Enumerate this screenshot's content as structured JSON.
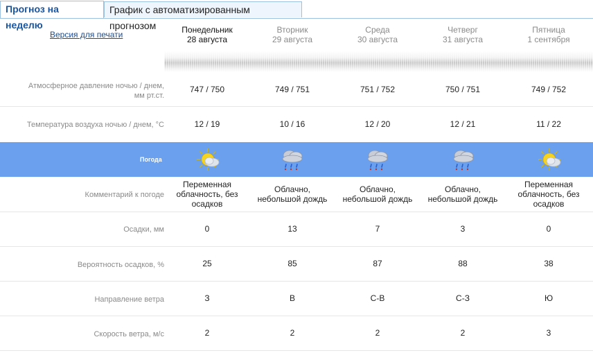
{
  "tabs": [
    {
      "label": "Прогноз на неделю",
      "active": true
    },
    {
      "label": "График с автоматизированным прогнозом",
      "active": false
    }
  ],
  "print_link": "Версия для печати",
  "days": [
    {
      "name": "Понедельник",
      "date": "28 августа",
      "active": true
    },
    {
      "name": "Вторник",
      "date": "29 августа",
      "active": false
    },
    {
      "name": "Среда",
      "date": "30 августа",
      "active": false
    },
    {
      "name": "Четверг",
      "date": "31 августа",
      "active": false
    },
    {
      "name": "Пятница",
      "date": "1 сентября",
      "active": false
    }
  ],
  "rows": {
    "pressure": {
      "label_line1": "Атмосферное давление ночью  /  днем,",
      "label_line2": "мм рт.ст.",
      "values": [
        "747  /  750",
        "749  /  751",
        "751  /  752",
        "750  /  751",
        "749  /  752"
      ]
    },
    "temperature": {
      "label": "Температура воздуха ночью  /  днем, °C",
      "values": [
        "12  /  19",
        "10  /  16",
        "12  /  20",
        "12  /  21",
        "11  /  22"
      ]
    },
    "weather": {
      "label": "Погода",
      "icons": [
        "partly-cloudy-sun-icon",
        "cloud-rain-icon",
        "cloud-rain-icon",
        "cloud-rain-icon",
        "partly-cloudy-sun-icon"
      ]
    },
    "comment": {
      "label": "Комментарий к погоде",
      "values": [
        [
          "Переменная",
          "облачность, без",
          "осадков"
        ],
        [
          "Облачно,",
          "небольшой дождь"
        ],
        [
          "Облачно,",
          "небольшой дождь"
        ],
        [
          "Облачно,",
          "небольшой дождь"
        ],
        [
          "Переменная",
          "облачность, без",
          "осадков"
        ]
      ]
    },
    "precip": {
      "label": "Осадки, мм",
      "values": [
        "0",
        "13",
        "7",
        "3",
        "0"
      ]
    },
    "probability": {
      "label": "Вероятность осадков, %",
      "values": [
        "25",
        "85",
        "87",
        "88",
        "38"
      ]
    },
    "wind_dir": {
      "label": "Направление ветра",
      "values": [
        "З",
        "В",
        "С-В",
        "С-З",
        "Ю"
      ]
    },
    "wind_speed": {
      "label": "Скорость ветра, м/с",
      "values": [
        "2",
        "2",
        "2",
        "2",
        "3"
      ]
    }
  },
  "colors": {
    "weather_bar": "#6aa0ee",
    "link": "#1e4b8f",
    "tab_border": "#9cc0e0"
  }
}
